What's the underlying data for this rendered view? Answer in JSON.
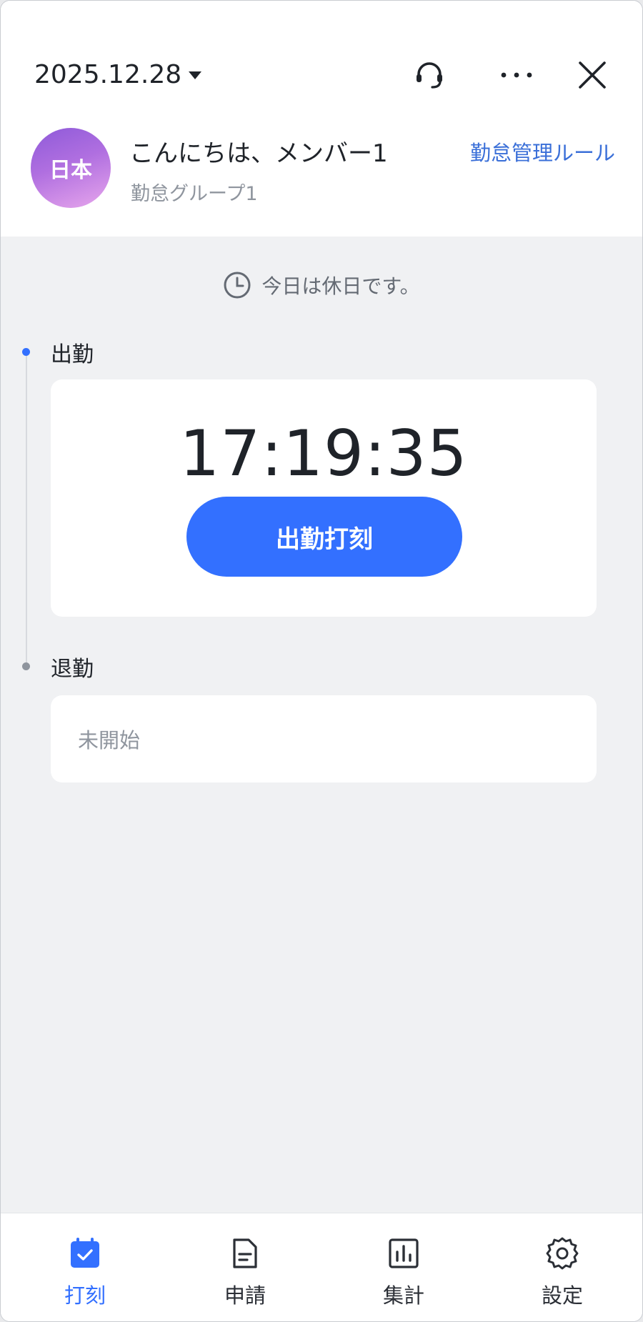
{
  "header": {
    "date": "2025.12.28",
    "support_icon": "headset-icon",
    "more_icon": "more-horizontal-icon",
    "close_icon": "close-icon",
    "avatar_text": "日本",
    "greeting": "こんにちは、メンバー1",
    "group": "勤怠グループ1",
    "rule_link": "勤怠管理ルール"
  },
  "notice": {
    "icon": "clock-icon",
    "text": "今日は休日です。"
  },
  "clock_in": {
    "label": "出勤",
    "time": "17:19:35",
    "button": "出勤打刻"
  },
  "clock_out": {
    "label": "退勤",
    "status": "未開始"
  },
  "nav": {
    "items": [
      {
        "label": "打刻",
        "icon": "calendar-check-icon",
        "active": true
      },
      {
        "label": "申請",
        "icon": "document-icon",
        "active": false
      },
      {
        "label": "集計",
        "icon": "bar-chart-icon",
        "active": false
      },
      {
        "label": "設定",
        "icon": "gear-icon",
        "active": false
      }
    ]
  },
  "colors": {
    "accent": "#3370ff",
    "background": "#f0f1f3",
    "card": "#ffffff"
  }
}
